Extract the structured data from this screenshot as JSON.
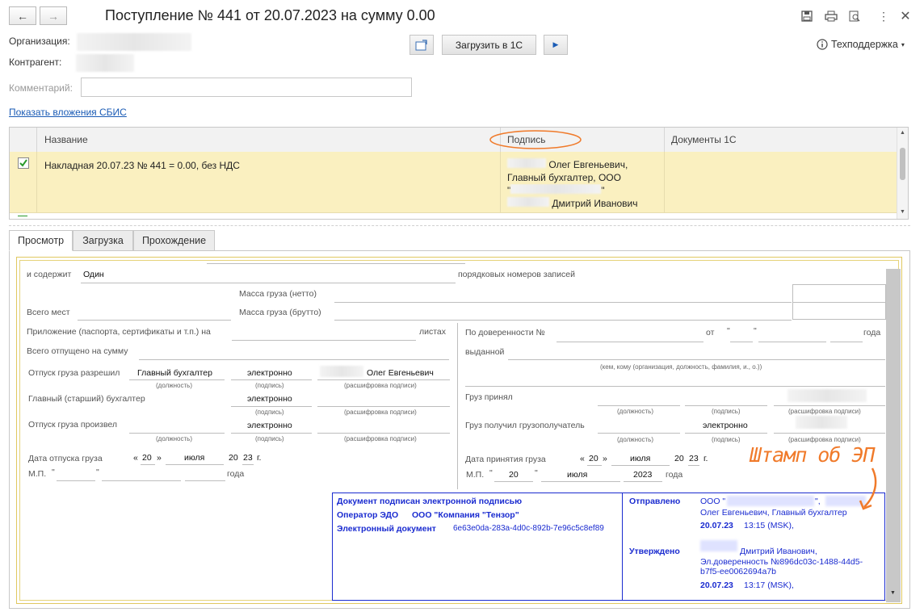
{
  "window": {
    "title": "Поступление № 441 от 20.07.2023 на сумму 0.00",
    "back_icon": "arrow-left-icon",
    "forward_icon": "arrow-right-icon"
  },
  "toolbar": {
    "load_button": "Загрузить в 1С",
    "support_label": "Техподдержка"
  },
  "form": {
    "org_label": "Организация:",
    "contractor_label": "Контрагент:",
    "comment_label": "Комментарий:",
    "comment_value": "",
    "attachments_link": "Показать вложения СБИС"
  },
  "table": {
    "columns": [
      "Название",
      "Подпись",
      "Документы 1С"
    ],
    "rows": [
      {
        "checked": true,
        "name": "Накладная 20.07.23 № 441 = 0.00, без НДС",
        "signature_line1": "Олег Евгеньевич,",
        "signature_line2": "Главный бухгалтер, ООО",
        "signature_line3": "\"",
        "signature_line3_end": "\"",
        "signature_line4": "Дмитрий Иванович",
        "docs_1c": ""
      }
    ]
  },
  "tabs": [
    "Просмотр",
    "Загрузка",
    "Прохождение"
  ],
  "document": {
    "contains_label": "и содержит",
    "contains_value": "Один",
    "records_label": "порядковых номеров записей",
    "mass_net": "Масса груза (нетто)",
    "total_places": "Всего мест",
    "mass_gross": "Масса груза (брутто)",
    "appendix_label": "Приложение (паспорта, сертификаты и т.п.) на",
    "sheets": "листах",
    "by_power": "По доверенности №",
    "from_word": "от",
    "quote_mark": "\"",
    "year_word": "года",
    "total_released": "Всего отпущено на сумму",
    "issued": "выданной",
    "who_to_whom": "(кем, кому (организация, должность, фамилия, и., о.))",
    "release_allowed": "Отпуск груза разрешил",
    "chief_accountant_value": "Главный бухгалтер",
    "electronic": "электронно",
    "signer_name": "Олег Евгеньевич",
    "position_hint": "(должность)",
    "signature_hint": "(подпись)",
    "decode_hint": "(расшифровка подписи)",
    "chief_label": "Главный (старший) бухгалтер",
    "cargo_received": "Груз принял",
    "released_by": "Отпуск груза произвел",
    "cargo_got": "Груз получил грузополучатель",
    "release_date": "Дата отпуска груза",
    "accept_date": "Дата принятия груза",
    "day_prefix": "«",
    "day": "20",
    "day_suffix": "»",
    "month": "июля",
    "year_prefix": "20",
    "year_suffix": "23",
    "year_abbr": "г.",
    "mp": "М.П.",
    "year_full": "2023"
  },
  "stamp": {
    "left_line1": "Документ подписан электронной подписью",
    "left_line2_label": "Оператор ЭДО",
    "left_line2_value": "ООО \"Компания \"Тензор\"",
    "left_line3_label": "Электронный документ",
    "left_line3_value": "6e63e0da-283a-4d0c-892b-7e96c5c8ef89",
    "sent_label": "Отправлено",
    "sent_org": "ООО \"",
    "sent_org_end": "\",",
    "sent_person": "Олег Евгеньевич, Главный бухгалтер",
    "sent_date": "20.07.23",
    "sent_time": "13:15 (MSK),",
    "approved_label": "Утверждено",
    "approved_person": "Дмитрий Иванович,",
    "approved_poa": "Эл.доверенность №896dc03c-1488-44d5-",
    "approved_poa2": "b7f5-ee0062694a7b",
    "approved_date": "20.07.23",
    "approved_time": "13:17 (MSK),"
  },
  "annotation": "Штамп об ЭП",
  "colors": {
    "row_highlight": "#faf0c0",
    "stamp_blue": "#1a2bd0",
    "annotation_orange": "#f07a2a",
    "link_blue": "#1a5bb5"
  }
}
